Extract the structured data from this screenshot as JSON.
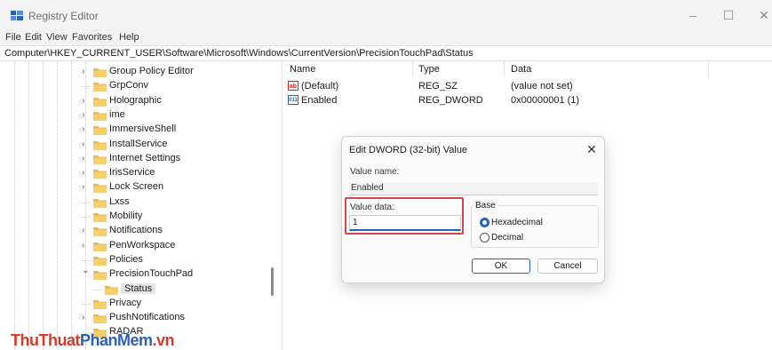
{
  "window": {
    "title": "Registry Editor"
  },
  "menu": [
    "File",
    "Edit",
    "View",
    "Favorites",
    "Help"
  ],
  "address": "Computer\\HKEY_CURRENT_USER\\Software\\Microsoft\\Windows\\CurrentVersion\\PrecisionTouchPad\\Status",
  "tree": [
    {
      "label": "Group Policy Editor",
      "expandable": true
    },
    {
      "label": "GrpConv",
      "expandable": false
    },
    {
      "label": "Holographic",
      "expandable": true
    },
    {
      "label": "ime",
      "expandable": true
    },
    {
      "label": "ImmersiveShell",
      "expandable": true
    },
    {
      "label": "InstallService",
      "expandable": true
    },
    {
      "label": "Internet Settings",
      "expandable": true
    },
    {
      "label": "IrisService",
      "expandable": true
    },
    {
      "label": "Lock Screen",
      "expandable": true
    },
    {
      "label": "Lxss",
      "expandable": false
    },
    {
      "label": "Mobility",
      "expandable": false
    },
    {
      "label": "Notifications",
      "expandable": true
    },
    {
      "label": "PenWorkspace",
      "expandable": true
    },
    {
      "label": "Policies",
      "expandable": false
    },
    {
      "label": "PrecisionTouchPad",
      "expandable": true,
      "expanded": true
    },
    {
      "label": "Status",
      "expandable": false,
      "selected": true,
      "child": true
    },
    {
      "label": "Privacy",
      "expandable": false
    },
    {
      "label": "PushNotifications",
      "expandable": true
    },
    {
      "label": "RADAR",
      "expandable": false
    }
  ],
  "list": {
    "columns": [
      "Name",
      "Type",
      "Data"
    ],
    "rows": [
      {
        "icon": "string-value-icon",
        "name": "(Default)",
        "type": "REG_SZ",
        "data": "(value not set)"
      },
      {
        "icon": "dword-value-icon",
        "name": "Enabled",
        "type": "REG_DWORD",
        "data": "0x00000001 (1)"
      }
    ]
  },
  "dialog": {
    "title": "Edit DWORD (32-bit) Value",
    "value_name_label": "Value name:",
    "value_name": "Enabled",
    "value_data_label": "Value data:",
    "value_data": "1",
    "base_label": "Base",
    "radio_hex": "Hexadecimal",
    "radio_dec": "Decimal",
    "base_selected": "Hexadecimal",
    "ok": "OK",
    "cancel": "Cancel",
    "highlight_color": "#d0474f"
  },
  "watermark": {
    "part1": "ThuThuat",
    "part2": "PhanMem",
    "part3": ".vn"
  },
  "colors": {
    "accent": "#2a62b8",
    "folder": "#e8b84a",
    "titlebar": "#f3f3f3"
  }
}
